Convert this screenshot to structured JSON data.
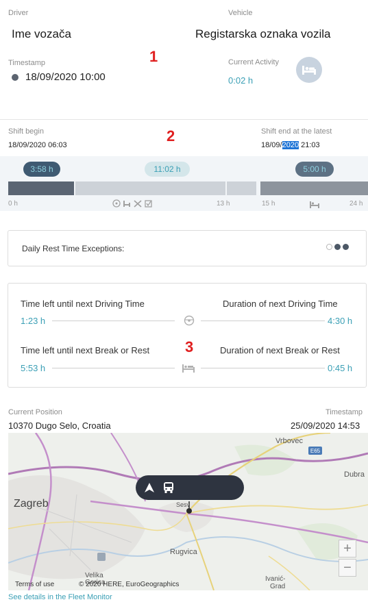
{
  "header": {
    "driver_label": "Driver",
    "driver_value": "Ime vozača",
    "vehicle_label": "Vehicle",
    "vehicle_value": "Registarska oznaka vozila",
    "timestamp_label": "Timestamp",
    "timestamp_value": "18/09/2020 10:00",
    "current_activity_label": "Current Activity",
    "current_activity_value": "0:02 h",
    "activity_icon": "bed-icon",
    "marker": "1"
  },
  "shift": {
    "begin_label": "Shift begin",
    "begin_value": "18/09/2020 06:03",
    "end_label": "Shift end at the latest",
    "end_value_pre": "18/09/",
    "end_value_selected": "2020",
    "end_value_post": " 21:03",
    "marker": "2",
    "pills": [
      "3:58 h",
      "11:02 h",
      "5:00 h"
    ],
    "axis": {
      "start": "0 h",
      "mid": "13 h",
      "right_start": "15 h",
      "end": "24 h"
    },
    "mid_icons": "steering-bed-tools-checkbox-icons",
    "rest_icon": "bed-icon"
  },
  "exceptions": {
    "label": "Daily Rest Time Exceptions:",
    "indicators": [
      "empty-clock",
      "full-clock",
      "full-clock"
    ]
  },
  "times": {
    "marker": "3",
    "row1_left_label": "Time left until next Driving Time",
    "row1_right_label": "Duration of next Driving Time",
    "row1_left_value": "1:23 h",
    "row1_right_value": "4:30 h",
    "row2_left_label": "Time left until next Break or Rest",
    "row2_right_label": "Duration of next Break or Rest",
    "row2_left_value": "5:53 h",
    "row2_right_value": "0:45 h"
  },
  "position": {
    "label": "Current Position",
    "value": "10370 Dugo Selo, Croatia",
    "timestamp_label": "Timestamp",
    "timestamp_value": "25/09/2020 14:53"
  },
  "map": {
    "city_zagreb": "Zagreb",
    "town_vrbovec": "Vrbovec",
    "town_dubrava": "Dubra",
    "town_rugvica": "Rugvica",
    "town_ivanic": "Ivanić-",
    "town_ivanic2": "Grad",
    "town_sesvete": "Sesv",
    "road_badge": "E65",
    "zoom_in": "+",
    "zoom_out": "−",
    "terms": "Terms of use",
    "copyright": "© 2020 HERE, EuroGeographics",
    "velika": "Velika",
    "gorica": "Gorica"
  },
  "footer_link": "See details in the Fleet Monitor"
}
